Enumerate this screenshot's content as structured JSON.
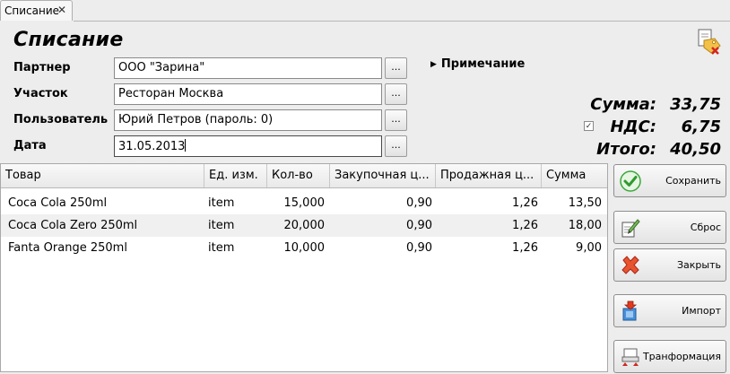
{
  "tab": {
    "label": "Списание",
    "close": "✕"
  },
  "page_title": "Списание",
  "form": {
    "partner": {
      "label": "Партнер",
      "value": "ООО \"Зарина\""
    },
    "location": {
      "label": "Участок",
      "value": "Ресторан Москва"
    },
    "user": {
      "label": "Пользователь",
      "value": "Юрий Петров (пароль: 0)"
    },
    "date": {
      "label": "Дата",
      "value": "31.05.2013"
    },
    "browse_label": "..."
  },
  "note": {
    "label": "Примечание"
  },
  "totals": {
    "sum_label": "Сумма:",
    "sum_value": "33,75",
    "vat_label": "НДС:",
    "vat_value": "6,75",
    "vat_checked": true,
    "total_label": "Итого:",
    "total_value": "40,50"
  },
  "table": {
    "columns": [
      "Товар",
      "Ед. изм.",
      "Кол-во",
      "Закупочная ц...",
      "Продажная ц...",
      "Сумма"
    ],
    "rows": [
      [
        "Coca Cola 250ml",
        "item",
        "15,000",
        "0,90",
        "1,26",
        "13,50"
      ],
      [
        "Coca Cola Zero 250ml",
        "item",
        "20,000",
        "0,90",
        "1,26",
        "18,00"
      ],
      [
        "Fanta Orange 250ml",
        "item",
        "10,000",
        "0,90",
        "1,26",
        "9,00"
      ]
    ]
  },
  "buttons": {
    "save": "Сохранить",
    "reset": "Сброс",
    "close": "Закрыть",
    "import": "Импорт",
    "transform": "Транформация"
  },
  "colors": {
    "accent_green": "#3aa83a",
    "close_red": "#e03a1e"
  }
}
